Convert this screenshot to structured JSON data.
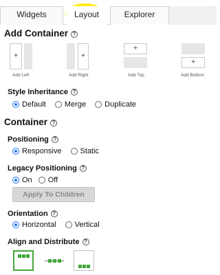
{
  "tabs": [
    {
      "label": "Widgets"
    },
    {
      "label": "Layout"
    },
    {
      "label": "Explorer"
    }
  ],
  "add_container": {
    "title": "Add Container",
    "buttons": [
      {
        "label": "Add Left",
        "symbol": "+"
      },
      {
        "label": "Add Right",
        "symbol": "+"
      },
      {
        "label": "Add Top",
        "symbol": "+"
      },
      {
        "label": "Add Bottom",
        "symbol": "+"
      }
    ]
  },
  "style_inheritance": {
    "label": "Style Inheritance",
    "options": [
      "Default",
      "Merge",
      "Duplicate"
    ],
    "selected": "Default"
  },
  "container": {
    "title": "Container"
  },
  "positioning": {
    "label": "Positioning",
    "options": [
      "Responsive",
      "Static"
    ],
    "selected": "Responsive"
  },
  "legacy_positioning": {
    "label": "Legacy Positioning",
    "options": [
      "On",
      "Off"
    ],
    "selected": "On"
  },
  "apply_button": "Apply To Children",
  "orientation": {
    "label": "Orientation",
    "options": [
      "Horizontal",
      "Vertical"
    ],
    "selected": "Horizontal"
  },
  "align_distribute": {
    "label": "Align and Distribute"
  },
  "colors": {
    "radio_selected": "#1a73e8",
    "align_accent": "#3fa535",
    "tab_highlight": "#ffea18"
  }
}
